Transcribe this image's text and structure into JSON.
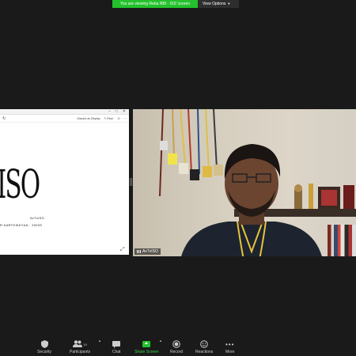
{
  "banner": {
    "viewing_text": "You are viewing Reba RBI - ISS' screen",
    "view_options_label": "View Options",
    "colors": {
      "banner_green": "#23c12c",
      "options_bg": "#2e2e2e"
    }
  },
  "shared_screen": {
    "toolbar_left": "↻",
    "toolbar_items": [
      "Discard as Display",
      "✎ Repl.",
      "⊡",
      "⋯"
    ],
    "window_controls": [
      "–",
      "□",
      "✕"
    ],
    "logo_text": "ISO",
    "brand_small": "AvTvISO",
    "author_line": "R KARTHIKEYAN · 2020S"
  },
  "participant": {
    "name": "AvTvISO"
  },
  "toolbar": {
    "security": "Security",
    "participants": "Participants",
    "participants_count": "19",
    "chat": "Chat",
    "share_screen": "Share Screen",
    "record": "Record",
    "reactions": "Reactions",
    "more": "More"
  }
}
